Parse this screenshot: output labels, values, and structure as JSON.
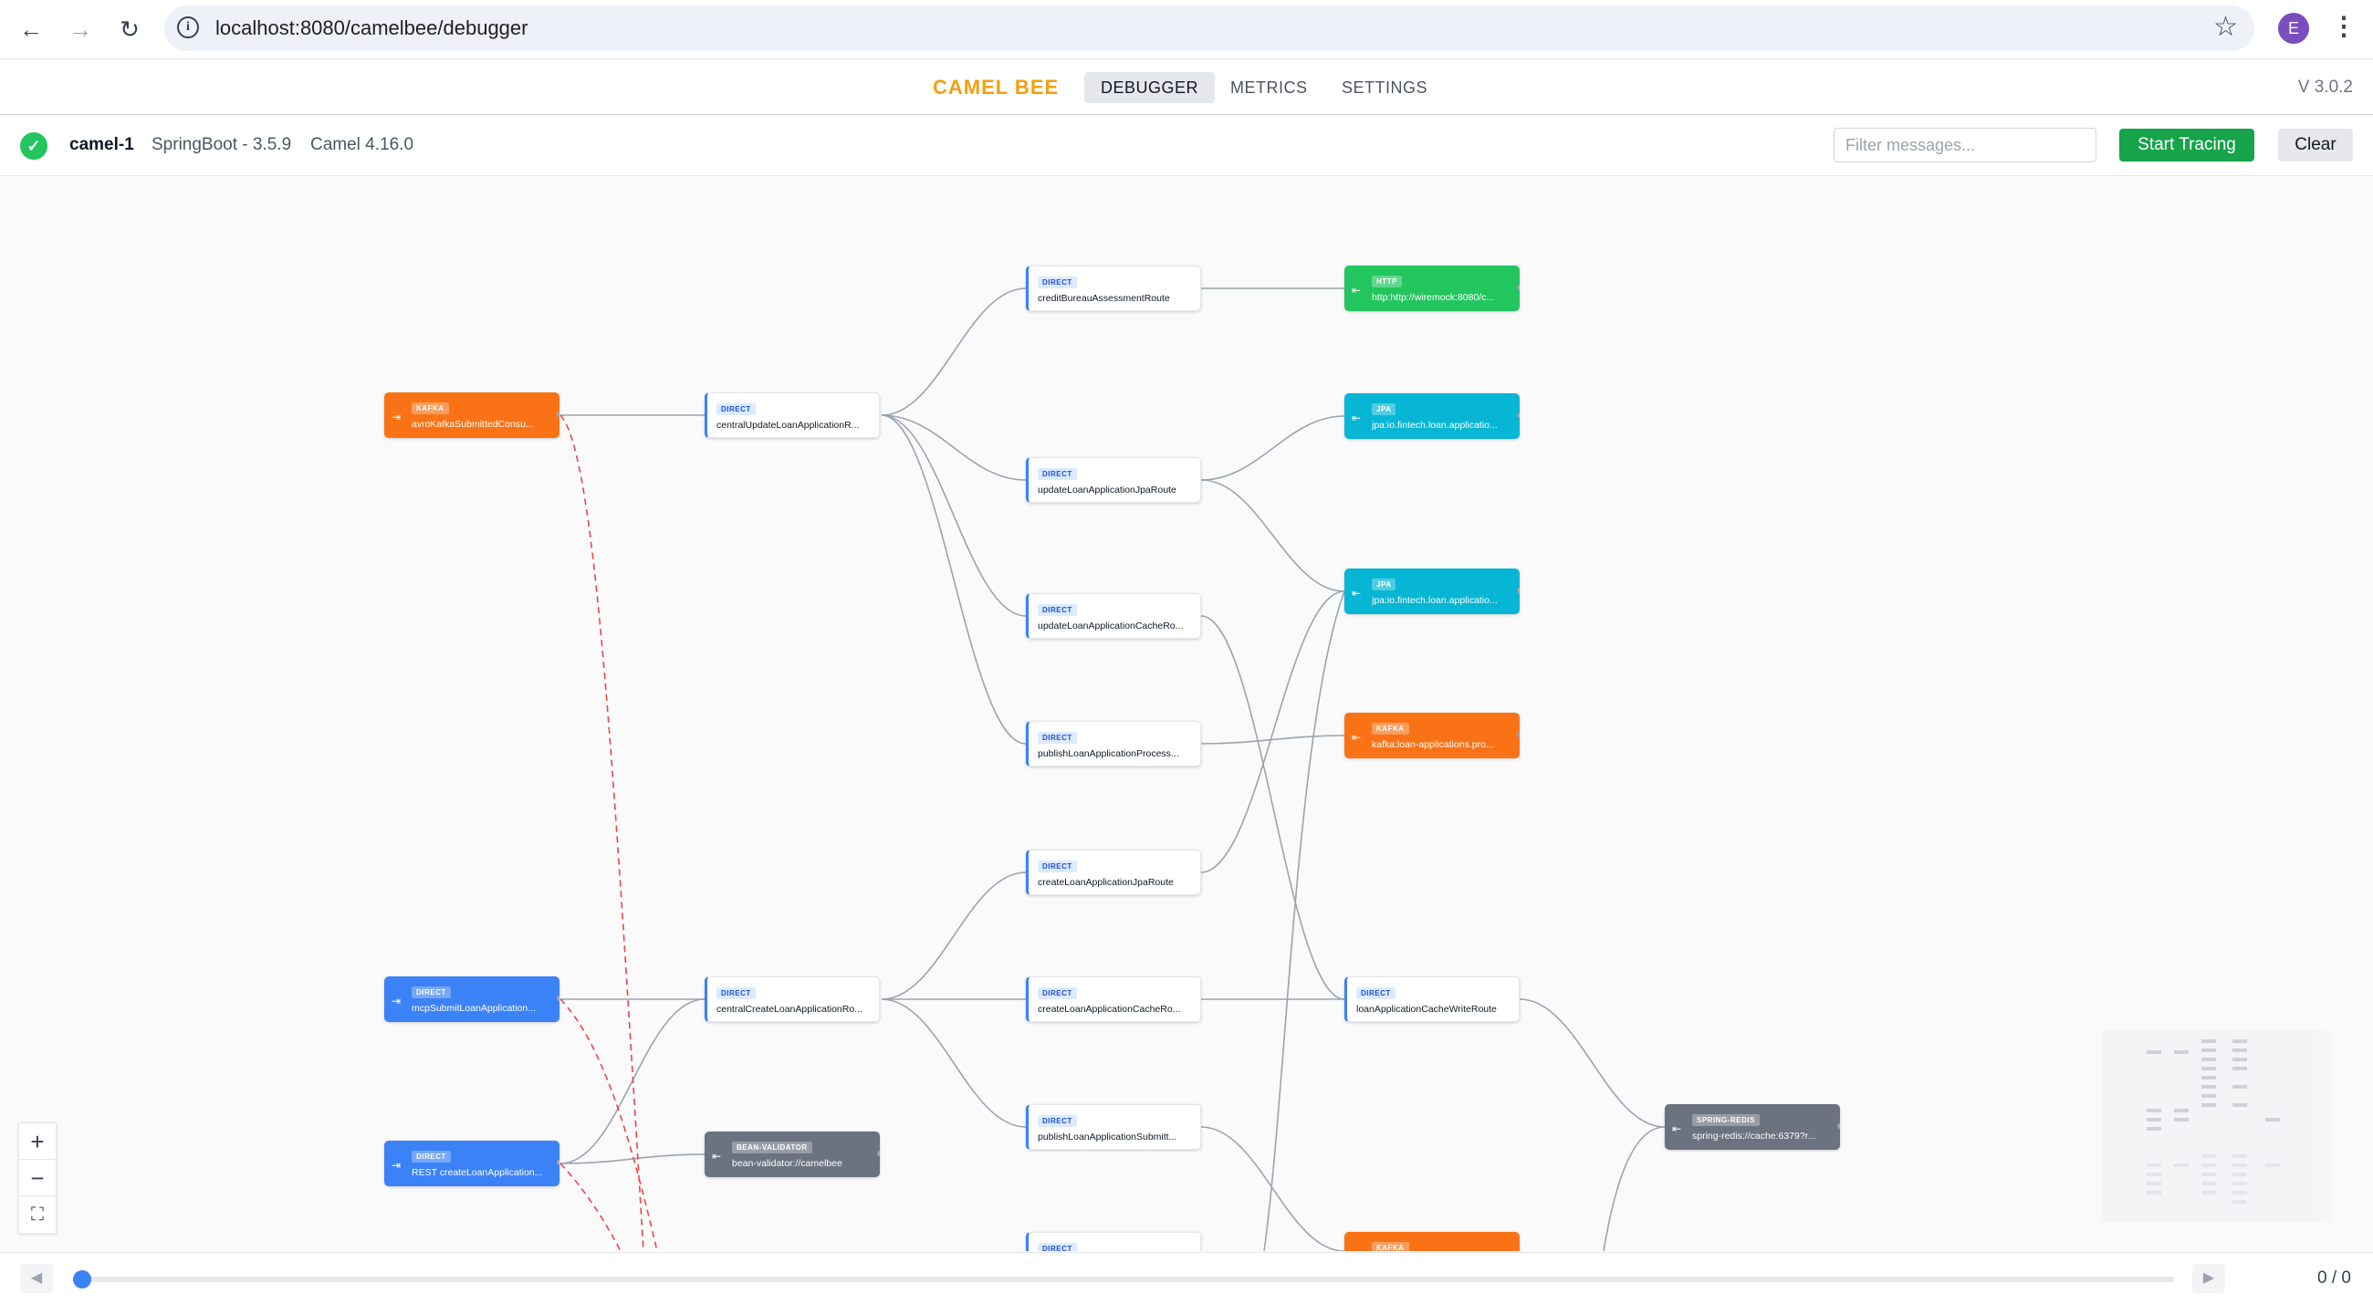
{
  "browser": {
    "url": "localhost:8080/camelbee/debugger",
    "avatar_letter": "E"
  },
  "header": {
    "brand": "CAMEL BEE",
    "tabs": [
      {
        "label": "DEBUGGER",
        "active": true
      },
      {
        "label": "METRICS",
        "active": false
      },
      {
        "label": "SETTINGS",
        "active": false
      }
    ],
    "version": "V 3.0.2"
  },
  "status": {
    "context_name": "camel-1",
    "runtime": "SpringBoot - 3.5.9",
    "camel_version": "Camel 4.16.0",
    "filter_placeholder": "Filter messages...",
    "start_label": "Start Tracing",
    "clear_label": "Clear"
  },
  "graph": {
    "colors": {
      "kafka": "#f97316",
      "direct": "#3b82f6",
      "http": "#22c55e",
      "jpa": "#06b6d4",
      "bean_validator": "#6b7280",
      "spring_redis": "#6b7280",
      "edge": "#9ca3af",
      "edge_error": "#ef4444"
    },
    "nodes": [
      {
        "id": "n1",
        "badge": "KAFKA",
        "label": "avroKafkaSubmittedConsu...",
        "kind": "kafka"
      },
      {
        "id": "n2",
        "badge": "DIRECT",
        "label": "mcpSubmitLoanApplication...",
        "kind": "direct-consumer"
      },
      {
        "id": "n3",
        "badge": "DIRECT",
        "label": "REST createLoanApplication...",
        "kind": "direct-consumer"
      },
      {
        "id": "n4",
        "badge": "DIRECT",
        "label": "centralUpdateLoanApplicationR...",
        "kind": "route"
      },
      {
        "id": "n5",
        "badge": "DIRECT",
        "label": "centralCreateLoanApplicationRo...",
        "kind": "route"
      },
      {
        "id": "n6",
        "badge": "BEAN-VALIDATOR",
        "label": "bean-validator://camelbee",
        "kind": "gray"
      },
      {
        "id": "n7",
        "badge": "DIRECT",
        "label": "creditBureauAssessmentRoute",
        "kind": "route"
      },
      {
        "id": "n8",
        "badge": "DIRECT",
        "label": "updateLoanApplicationJpaRoute",
        "kind": "route"
      },
      {
        "id": "n9",
        "badge": "DIRECT",
        "label": "updateLoanApplicationCacheRo...",
        "kind": "route"
      },
      {
        "id": "n10",
        "badge": "DIRECT",
        "label": "publishLoanApplicationProcess...",
        "kind": "route"
      },
      {
        "id": "n11",
        "badge": "DIRECT",
        "label": "createLoanApplicationJpaRoute",
        "kind": "route"
      },
      {
        "id": "n12",
        "badge": "DIRECT",
        "label": "createLoanApplicationCacheRo...",
        "kind": "route"
      },
      {
        "id": "n13",
        "badge": "DIRECT",
        "label": "publishLoanApplicationSubmitt...",
        "kind": "route"
      },
      {
        "id": "n14",
        "badge": "DIRECT",
        "label": "",
        "kind": "route"
      },
      {
        "id": "n15",
        "badge": "HTTP",
        "label": "http:http://wiremock:8080/c...",
        "kind": "http"
      },
      {
        "id": "n16",
        "badge": "JPA",
        "label": "jpa:io.fintech.loan.applicatio...",
        "kind": "jpa"
      },
      {
        "id": "n17",
        "badge": "JPA",
        "label": "jpa:io.fintech.loan.applicatio...",
        "kind": "jpa"
      },
      {
        "id": "n18",
        "badge": "KAFKA",
        "label": "kafka:loan-applications.pro...",
        "kind": "kafka"
      },
      {
        "id": "n19",
        "badge": "DIRECT",
        "label": "loanApplicationCacheWriteRoute",
        "kind": "route"
      },
      {
        "id": "n20",
        "badge": "KAFKA",
        "label": "",
        "kind": "kafka"
      },
      {
        "id": "n21",
        "badge": "SPRING-REDIS",
        "label": "spring-redis://cache:6379?r...",
        "kind": "gray"
      }
    ]
  },
  "zoom": {
    "in": "+",
    "out": "−",
    "fit": "⛶"
  },
  "timeline": {
    "prev": "◀",
    "next": "▶",
    "count": "0 / 0",
    "progress": 0
  }
}
